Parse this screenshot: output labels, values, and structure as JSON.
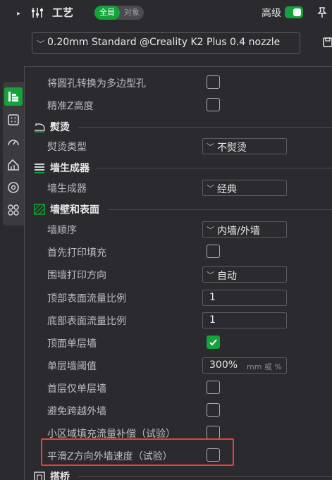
{
  "header": {
    "title": "工艺",
    "scope_global": "全局",
    "scope_object": "对象",
    "advanced_label": "高级",
    "advanced_enabled": true
  },
  "preset": {
    "selected": "0.20mm Standard @Creality K2 Plus 0.4 nozzle"
  },
  "colors": {
    "accent": "#14a33a",
    "highlight": "#e8403a",
    "background": "#2b2b2f"
  },
  "icons": {
    "rail": [
      "layers-icon",
      "infill-grid-icon",
      "speed-gauge-icon",
      "support-icon",
      "filament-spool-icon",
      "multi-shape-icon"
    ],
    "header": [
      "sliders-icon",
      "pin-icon",
      "save-icon"
    ]
  },
  "settings": {
    "top_rows": [
      {
        "label": "将圆孔转换为多边型孔",
        "checked": false
      },
      {
        "label": "精准Z高度",
        "checked": false
      }
    ],
    "ironing": {
      "title": "熨烫",
      "type_label": "熨烫类型",
      "type_value": "不熨烫"
    },
    "wall_generator": {
      "title": "墙生成器",
      "label": "墙生成器",
      "value": "经典"
    },
    "walls_surfaces": {
      "title": "墙壁和表面",
      "wall_order_label": "墙顺序",
      "wall_order_value": "内墙/外墙",
      "infill_first_label": "首先打印填充",
      "infill_first_checked": false,
      "wall_direction_label": "围墙打印方向",
      "wall_direction_value": "自动",
      "top_flow_label": "顶部表面流量比例",
      "top_flow_value": "1",
      "bottom_flow_label": "底部表面流量比例",
      "bottom_flow_value": "1",
      "top_one_wall_label": "顶面单层墙",
      "top_one_wall_checked": true,
      "one_wall_threshold_label": "单层墙阈值",
      "one_wall_threshold_value": "300%",
      "one_wall_threshold_unit": "mm 或 %",
      "first_layer_one_wall_label": "首层仅单层墙",
      "first_layer_one_wall_checked": false,
      "avoid_crossing_label": "避免跨越外墙",
      "avoid_crossing_checked": false,
      "small_area_flow_label": "小区域填充流量补偿（试验）",
      "small_area_flow_checked": false,
      "smooth_z_label": "平滑Z方向外墙速度（试验）",
      "smooth_z_checked": false
    },
    "bridging": {
      "title": "搭桥"
    }
  }
}
